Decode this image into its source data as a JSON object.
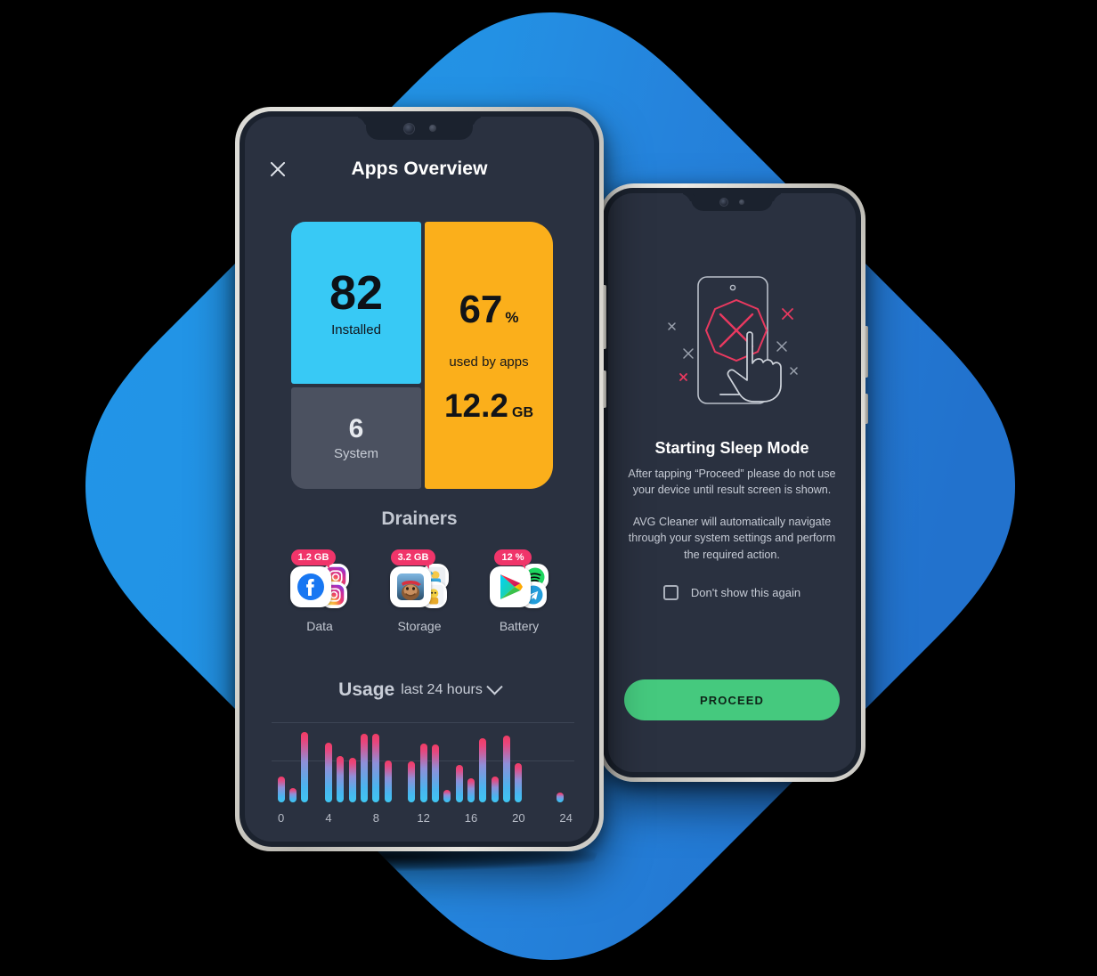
{
  "background": {
    "shape": "rounded-diamond",
    "color_light": "#2196e8",
    "color_dark": "#2278d2"
  },
  "phone_front": {
    "appbar": {
      "close_icon": "close-x-icon",
      "title": "Apps Overview"
    },
    "cards": {
      "installed": {
        "value": "82",
        "label": "Installed",
        "color": "#38c9f5"
      },
      "system": {
        "value": "6",
        "label": "System",
        "color": "#4b5160"
      },
      "usage": {
        "percent": "67",
        "percent_unit": "%",
        "caption": "used by apps",
        "size": "12.2",
        "size_unit": "GB",
        "color": "#fbaf1b"
      }
    },
    "drainers": {
      "title": "Drainers",
      "badge_color": "#f0356a",
      "items": [
        {
          "badge": "1.2 GB",
          "label": "Data",
          "icon": "facebook-icon",
          "stack": [
            "instagram-icon",
            "instagram-icon"
          ]
        },
        {
          "badge": "3.2 GB",
          "label": "Storage",
          "icon": "game-app-icon",
          "stack": [
            "game-app-icon",
            "game-app-icon"
          ]
        },
        {
          "badge": "12 %",
          "label": "Battery",
          "icon": "google-play-icon",
          "stack": [
            "spotify-icon",
            "telegram-icon"
          ]
        }
      ]
    },
    "usage_section": {
      "title": "Usage",
      "subtitle": "last 24 hours",
      "chevron_icon": "chevron-down-icon"
    },
    "chart_data": {
      "type": "bar",
      "title": "Usage",
      "subtitle": "last 24 hours",
      "xlabel": "",
      "ylabel": "",
      "grid": true,
      "gridlines": [
        0.52,
        1.0
      ],
      "legend": "none",
      "xticks": [
        0,
        4,
        8,
        12,
        16,
        20,
        24
      ],
      "xlim": [
        -0.5,
        25
      ],
      "ylim": [
        0,
        1
      ],
      "bar_color_low": "#3fc6f2",
      "bar_color_high": "#f13c63",
      "x": [
        0,
        1,
        2,
        3,
        4,
        5,
        6,
        7,
        8,
        9,
        11,
        12,
        13,
        14,
        15,
        16,
        17,
        18,
        19,
        20,
        21,
        23.5
      ],
      "values": [
        0.34,
        0.19,
        0.94,
        0.0,
        0.8,
        0.62,
        0.6,
        0.92,
        0.92,
        0.56,
        0.55,
        0.78,
        0.77,
        0.17,
        0.5,
        0.32,
        0.86,
        0.35,
        0.89,
        0.52,
        0.0,
        0.13
      ]
    }
  },
  "phone_back": {
    "illustration": "phone-tap-blocked-icon",
    "title": "Starting Sleep Mode",
    "paragraph_1": "After tapping “Proceed” please do not use your device until result screen is shown.",
    "paragraph_2": "AVG Cleaner will automatically navigate through your system settings and perform the required action.",
    "checkbox_label": "Don't show this again",
    "checkbox_checked": false,
    "button_label": "PROCEED",
    "button_color": "#45c97e"
  }
}
